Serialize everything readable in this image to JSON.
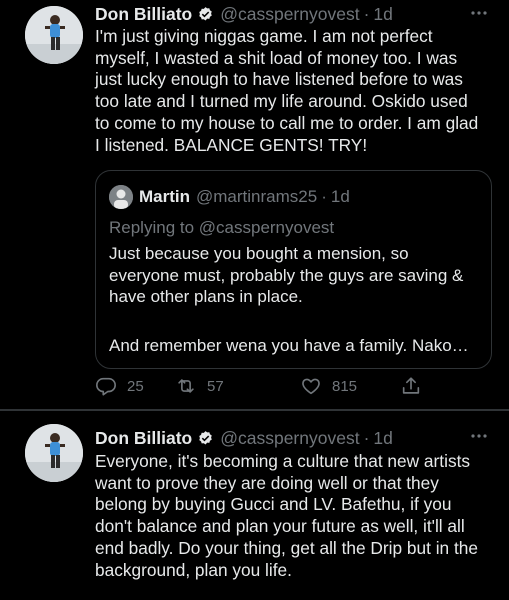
{
  "tweets": [
    {
      "author_name": "Don Billiato",
      "handle": "@casspernyovest",
      "dot": "·",
      "time": "1d",
      "text": "I'm  just giving niggas game. I am not perfect\nmyself,  I wasted a shit load of money too. I was\njust lucky enough to have listened before to was\ntoo late and I turned my life around. Oskido used\nto come to my house to call me to order. I am glad\nI listened. BALANCE GENTS! TRY!",
      "quote": {
        "author_name": "Martin",
        "handle": "@martinrams25",
        "dot": "·",
        "time": "1d",
        "replying_to": "Replying to @casspernyovest",
        "text": "Just because you bought a mension, so\neveryone must, probably the guys are saving &\nhave other plans in place.",
        "text2": "And remember wena you have a family. Nako…"
      },
      "actions": {
        "replies": "25",
        "retweets": "57",
        "likes": "815"
      }
    },
    {
      "author_name": "Don Billiato",
      "handle": "@casspernyovest",
      "dot": "·",
      "time": "1d",
      "text": "Everyone, it's becoming a culture that new artists\nwant to prove they are doing well or that they\nbelong by buying Gucci and LV. Bafethu, if you\ndon't balance and plan your future as well, it'll all\nend badly. Do your thing, get all the Drip but in the\nbackground, plan you life."
    }
  ],
  "icons": {
    "verified": "verified-badge-icon",
    "more": "more-options-icon",
    "reply": "reply-icon",
    "retweet": "retweet-icon",
    "like": "heart-icon",
    "share": "share-icon"
  },
  "colors": {
    "background": "#000000",
    "text": "#e7e9ea",
    "secondary_text": "#71767b",
    "border": "#2f3336",
    "verified": "#1d9bf0"
  }
}
